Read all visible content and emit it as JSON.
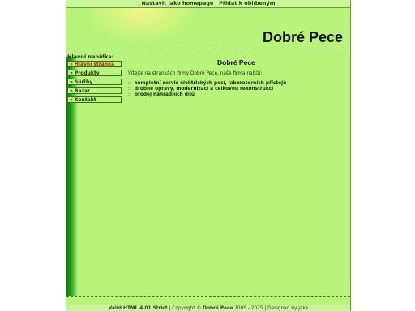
{
  "topbar": {
    "homepage_link": "Nastavit jako homepage",
    "separator": "|",
    "favorites_link": "Přidat k oblíbeným"
  },
  "header": {
    "site_title": "Dobré Pece"
  },
  "nav": {
    "heading": "Hlavní nabídka:",
    "arrow": "»",
    "items": [
      {
        "label": "Hlavní stránka"
      },
      {
        "label": "Produkty"
      },
      {
        "label": "Služby"
      },
      {
        "label": "Bazar"
      },
      {
        "label": "Kontakt"
      }
    ]
  },
  "main": {
    "title": "Dobré Pece",
    "intro": "Vítejte na stránkách firmy Dobré Pece, naše firma nabízí:",
    "bullet": "::",
    "services": [
      "kompletní servis elektrických pecí, laboratorních přístojů",
      "drobné opravy, modernizaci a celkovou rekonstrukci",
      "prodej náhradních dílů"
    ]
  },
  "footer": {
    "valid": "Valid HTML 4.01 Strict",
    "sep1": "|",
    "copyright_prefix": "Copyright ©",
    "copyright_name": "Dobré Pece",
    "years": "2005 - 2025",
    "sep2": "|",
    "designed": "Designed by Jake"
  },
  "colors": {
    "page_bg": "#b8f47c",
    "active_nav": "#c0180c",
    "sidebar_gradient_dark": "#0f7a12"
  }
}
